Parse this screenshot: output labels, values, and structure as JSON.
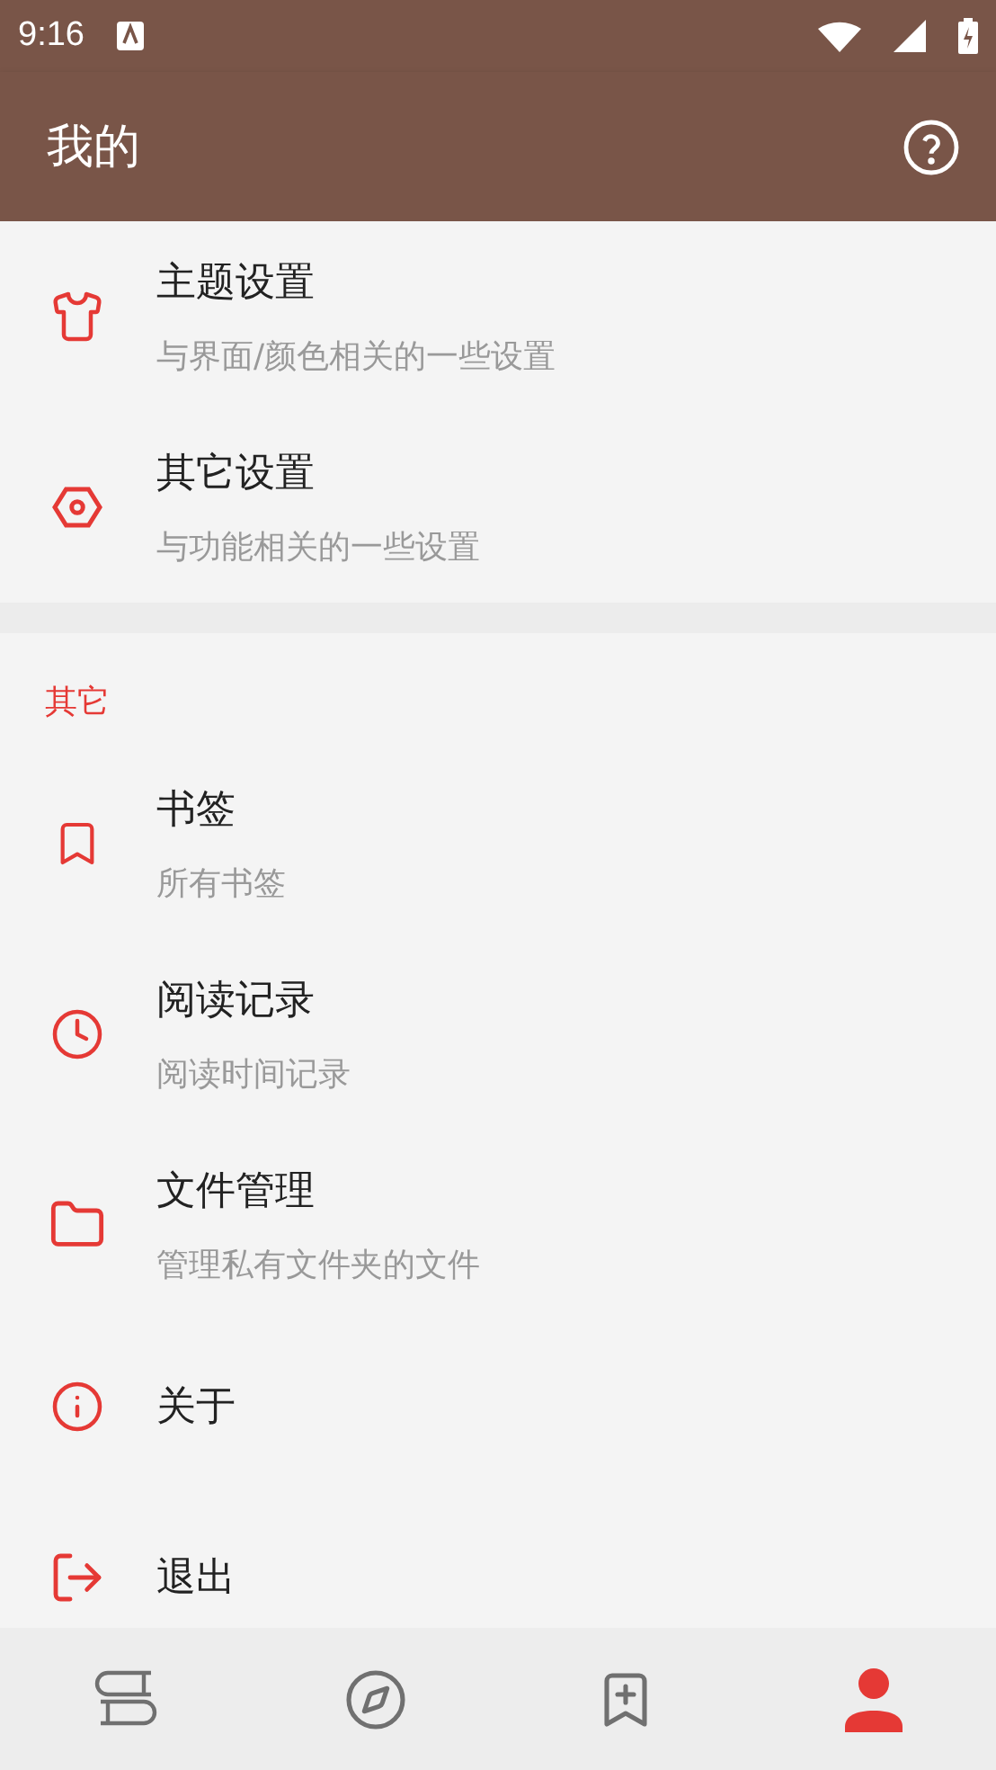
{
  "status_bar": {
    "time": "9:16"
  },
  "app_bar": {
    "title": "我的"
  },
  "sections": [
    {
      "items": [
        {
          "title": "主题设置",
          "subtitle": "与界面/颜色相关的一些设置"
        },
        {
          "title": "其它设置",
          "subtitle": "与功能相关的一些设置"
        }
      ]
    },
    {
      "header": "其它",
      "items": [
        {
          "title": "书签",
          "subtitle": "所有书签"
        },
        {
          "title": "阅读记录",
          "subtitle": "阅读时间记录"
        },
        {
          "title": "文件管理",
          "subtitle": "管理私有文件夹的文件"
        },
        {
          "title": "关于"
        },
        {
          "title": "退出"
        }
      ]
    }
  ],
  "bottom_nav": [
    {
      "selected": false
    },
    {
      "selected": false
    },
    {
      "selected": false
    },
    {
      "selected": true
    }
  ]
}
